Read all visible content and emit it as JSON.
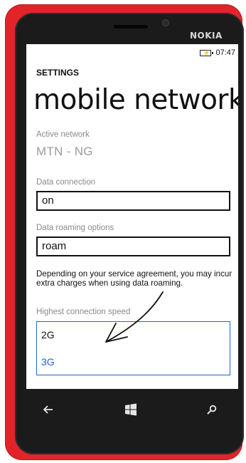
{
  "device": {
    "brand": "NOKIA"
  },
  "status_bar": {
    "time": "07:47",
    "battery_icon": "battery-charging-icon"
  },
  "header": {
    "app_title": "SETTINGS",
    "page_title": "mobile network"
  },
  "active_network": {
    "label": "Active network",
    "value": "MTN - NG"
  },
  "data_connection": {
    "label": "Data connection",
    "value": "on"
  },
  "data_roaming": {
    "label": "Data roaming options",
    "value": "roam"
  },
  "roaming_note": "Depending on your service agreement, you may incur extra charges when using data roaming.",
  "connection_speed": {
    "label": "Highest connection speed",
    "options": [
      "2G",
      "3G"
    ],
    "selected": "3G"
  },
  "nav": {
    "back_icon": "back-arrow-icon",
    "start_icon": "windows-start-icon",
    "search_icon": "search-icon"
  },
  "colors": {
    "phone": "#e2242a",
    "accent": "#1e63d6"
  }
}
